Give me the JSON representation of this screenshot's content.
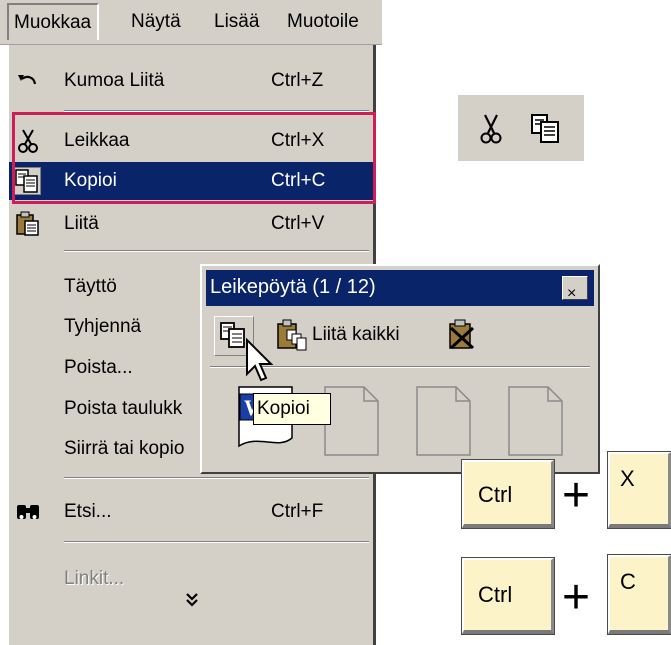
{
  "menubar": {
    "items": [
      {
        "label": "Muokkaa",
        "active": true
      },
      {
        "label": "Näytä"
      },
      {
        "label": "Lisää"
      },
      {
        "label": "Muotoile"
      }
    ]
  },
  "menu": {
    "undo": {
      "label": "Kumoa Liitä",
      "shortcut": "Ctrl+Z",
      "icon": "undo-icon"
    },
    "cut": {
      "label": "Leikkaa",
      "shortcut": "Ctrl+X",
      "icon": "scissors-icon"
    },
    "copy": {
      "label": "Kopioi",
      "shortcut": "Ctrl+C",
      "icon": "copy-icon"
    },
    "paste": {
      "label": "Liitä",
      "shortcut": "Ctrl+V",
      "icon": "paste-icon"
    },
    "fill": {
      "label": "Täyttö"
    },
    "clear": {
      "label": "Tyhjennä"
    },
    "delete": {
      "label": "Poista..."
    },
    "delete_sheet": {
      "label": "Poista taulukk"
    },
    "move_copy": {
      "label": "Siirrä tai kopio"
    },
    "find": {
      "label": "Etsi...",
      "shortcut": "Ctrl+F",
      "icon": "binoculars-icon"
    },
    "links": {
      "label": "Linkit...",
      "disabled": true
    },
    "more": {
      "icon": "double-chevron-down-icon"
    }
  },
  "clipboard": {
    "title": "Leikepöytä (1 / 12)",
    "close_label": "×",
    "paste_all_label": "Liitä kaikki",
    "tooltip": "Kopioi"
  },
  "keys": {
    "ctrl": "Ctrl",
    "plus": "+",
    "x": "X",
    "c": "C"
  },
  "colors": {
    "menu_bg": "#d4d0c8",
    "highlight": "#0a246a",
    "emphasis_box": "#cc1f5a",
    "tooltip_bg": "#ffffe1",
    "keycap": "#fdf3c8"
  }
}
